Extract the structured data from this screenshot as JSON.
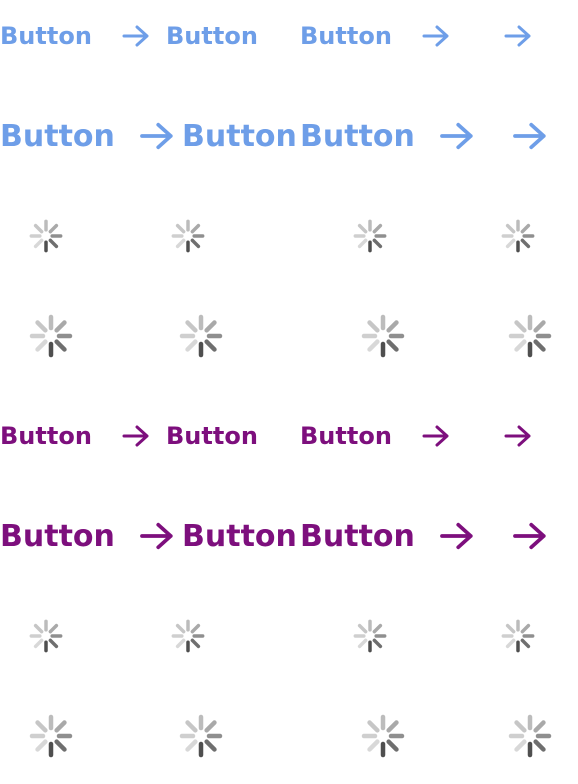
{
  "rows": [
    {
      "kind": "button",
      "size": "sm",
      "color": "#6e9ee8",
      "items": [
        {
          "label": "Button",
          "arrow": true
        },
        {
          "label": "Button",
          "arrow": false
        },
        {
          "label": "Button",
          "arrow": true
        },
        {
          "label": "",
          "arrow": true
        }
      ]
    },
    {
      "kind": "button",
      "size": "lg",
      "color": "#6e9ee8",
      "items": [
        {
          "label": "Button",
          "arrow": true
        },
        {
          "label": "Button",
          "arrow": false
        },
        {
          "label": "Button",
          "arrow": true
        },
        {
          "label": "",
          "arrow": true
        }
      ]
    },
    {
      "kind": "spinner",
      "size": "sm",
      "items": [
        {},
        {},
        {},
        {}
      ]
    },
    {
      "kind": "spinner",
      "size": "lg",
      "items": [
        {},
        {},
        {},
        {}
      ]
    },
    {
      "kind": "button",
      "size": "sm",
      "color": "#7d0f7d",
      "items": [
        {
          "label": "Button",
          "arrow": true
        },
        {
          "label": "Button",
          "arrow": false
        },
        {
          "label": "Button",
          "arrow": true
        },
        {
          "label": "",
          "arrow": true
        }
      ]
    },
    {
      "kind": "button",
      "size": "lg",
      "color": "#7d0f7d",
      "items": [
        {
          "label": "Button",
          "arrow": true
        },
        {
          "label": "Button",
          "arrow": false
        },
        {
          "label": "Button",
          "arrow": true
        },
        {
          "label": "",
          "arrow": true
        }
      ]
    },
    {
      "kind": "spinner",
      "size": "sm",
      "items": [
        {},
        {},
        {},
        {}
      ]
    },
    {
      "kind": "spinner",
      "size": "lg",
      "items": [
        {},
        {},
        {},
        {}
      ]
    }
  ],
  "icons": {
    "arrow": "arrow-right-icon",
    "spinner": "loading-spinner-icon"
  }
}
